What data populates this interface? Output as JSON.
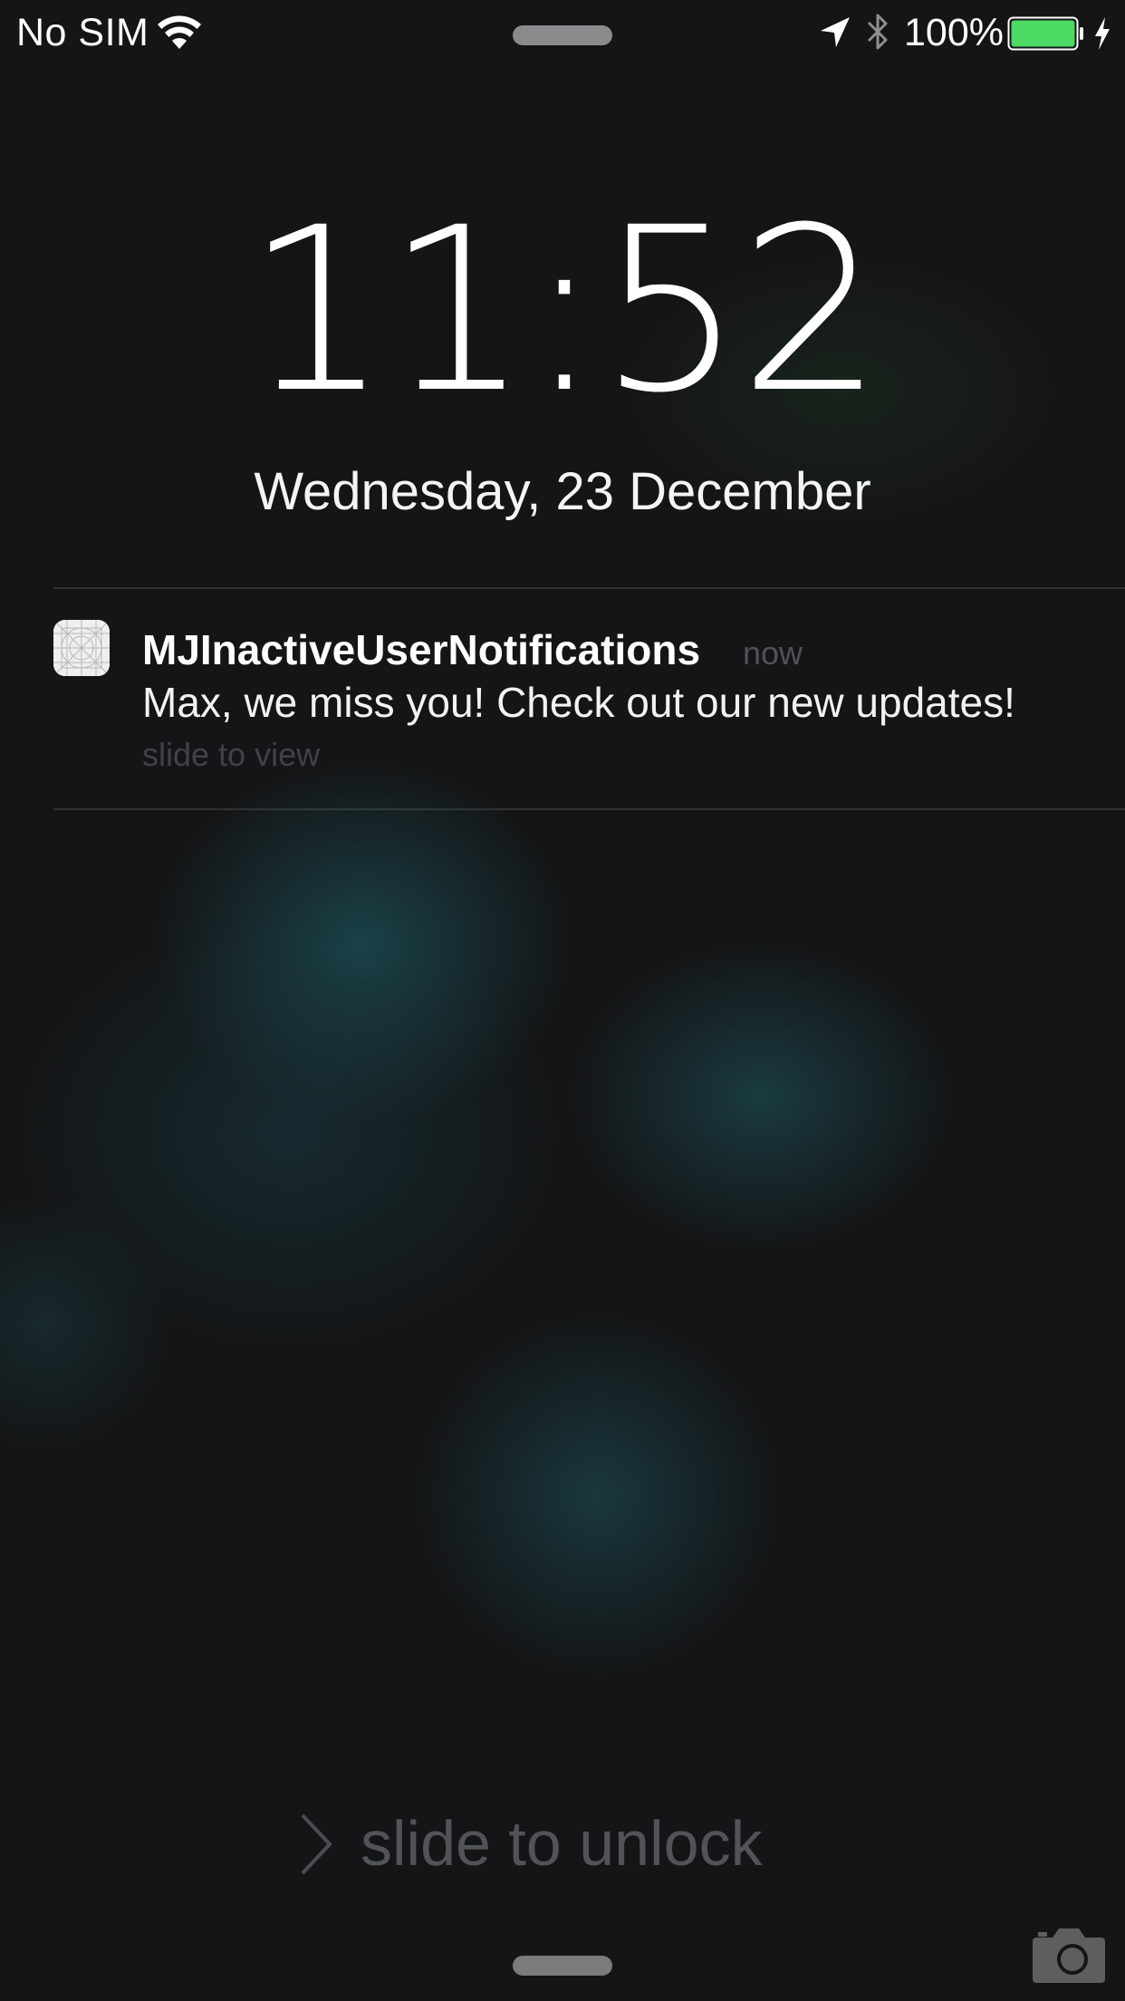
{
  "status_bar": {
    "carrier": "No SIM",
    "battery_percent": "100%",
    "battery_level": 1.0,
    "battery_color": "#4cd964",
    "icons": [
      "wifi-icon",
      "location-icon",
      "bluetooth-icon",
      "battery-icon",
      "charging-icon"
    ]
  },
  "lock_screen": {
    "time": "11:52",
    "date": "Wednesday, 23 December"
  },
  "notification": {
    "app_icon": "app-placeholder-icon",
    "app_name": "MJInactiveUserNotifications",
    "time": "now",
    "message": "Max, we miss you! Check out our new updates!",
    "action": "slide to view"
  },
  "bottom": {
    "unlock_label": "slide to unlock",
    "icons": [
      "chevron-right-icon",
      "camera-icon"
    ]
  }
}
